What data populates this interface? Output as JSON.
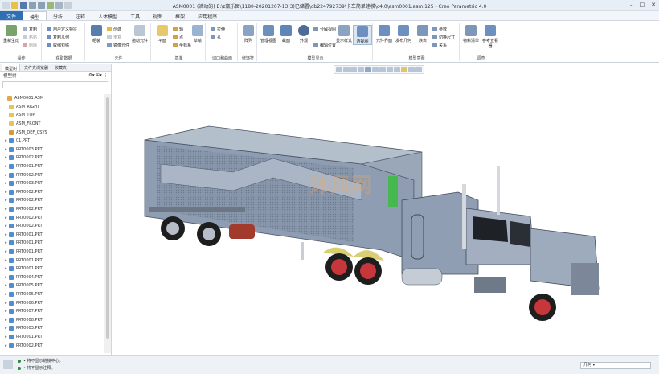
{
  "title": "ASM0001 (活动的) E:\\z赢乐图\\1180-20201207-13(3)已储置\\db224792739\\卡车简单建模\\c4.0\\asm0001.asm.125 - Creo Parametric 4.0",
  "tabs": [
    "文件",
    "模型",
    "分析",
    "注释",
    "人体模型",
    "工具",
    "视图",
    "框架",
    "应用程序"
  ],
  "ribbon": {
    "group_labels": [
      "操作",
      "获取数据",
      "元件",
      "基准",
      "切口和曲面",
      "修饰符",
      "模型显示",
      "模型意图",
      "调查"
    ],
    "buttons": {
      "regenerate": "重新生成",
      "copy": "复制",
      "paste": "粘贴",
      "delete": "删除",
      "user_feature": "用户定义特征",
      "copy_geom": "复制几何",
      "shrinkwrap": "收缩包络",
      "assemble": "组装",
      "create": "创建",
      "repeat": "重复",
      "mirror": "镜像元件",
      "drag": "拖动元件",
      "plane": "平面",
      "axis": "轴",
      "point": "点",
      "csys": "坐标系",
      "sketch": "草绘",
      "extrude": "拉伸",
      "hole": "孔",
      "pattern": "阵列",
      "manage_views": "管理视图",
      "section": "截面",
      "appearance": "外观",
      "explode": "分解视图",
      "edit_pos": "编辑位置",
      "display_style": "显示样式",
      "perspective": "透视图",
      "comp_interface": "元件界面",
      "publish_geom": "发布几何",
      "family_table": "族表",
      "params": "参数",
      "switch_dims": "切换尺寸",
      "relations": "关系",
      "bom": "物料清单",
      "ref_viewer": "参考查看器"
    }
  },
  "panel": {
    "tabs": [
      "模型树",
      "文件夹浏览器",
      "收藏夹"
    ],
    "toolbar_label": "模型树",
    "tree": [
      {
        "label": "ASM0001.ASM",
        "type": "asm",
        "arrow": ""
      },
      {
        "label": "ASM_RIGHT",
        "type": "plane",
        "arrow": ""
      },
      {
        "label": "ASM_TOP",
        "type": "plane",
        "arrow": ""
      },
      {
        "label": "ASM_FRONT",
        "type": "plane",
        "arrow": ""
      },
      {
        "label": "ASM_DEF_CSYS",
        "type": "csys",
        "arrow": ""
      },
      {
        "label": "01.PRT",
        "type": "part",
        "arrow": "▸"
      },
      {
        "label": "PRT0003.PRT",
        "type": "part",
        "arrow": "▸"
      },
      {
        "label": "PRT0002.PRT",
        "type": "part",
        "arrow": "▸"
      },
      {
        "label": "PRT0001.PRT",
        "type": "part",
        "arrow": "▸"
      },
      {
        "label": "PRT0002.PRT",
        "type": "part",
        "arrow": "▸"
      },
      {
        "label": "PRT0003.PRT",
        "type": "part",
        "arrow": "▸"
      },
      {
        "label": "PRT0002.PRT",
        "type": "part",
        "arrow": "▸"
      },
      {
        "label": "PRT0002.PRT",
        "type": "part",
        "arrow": "▸"
      },
      {
        "label": "PRT0002.PRT",
        "type": "part",
        "arrow": "▸"
      },
      {
        "label": "PRT0002.PRT",
        "type": "part",
        "arrow": "▸"
      },
      {
        "label": "PRT0002.PRT",
        "type": "part",
        "arrow": "▸"
      },
      {
        "label": "PRT0001.PRT",
        "type": "part",
        "arrow": "▸"
      },
      {
        "label": "PRT0001.PRT",
        "type": "part",
        "arrow": "▸"
      },
      {
        "label": "PRT0001.PRT",
        "type": "part",
        "arrow": "▸"
      },
      {
        "label": "PRT0001.PRT",
        "type": "part",
        "arrow": "▸"
      },
      {
        "label": "PRT0001.PRT",
        "type": "part",
        "arrow": "▸"
      },
      {
        "label": "PRT0004.PRT",
        "type": "part",
        "arrow": "▸"
      },
      {
        "label": "PRT0005.PRT",
        "type": "part",
        "arrow": "▸"
      },
      {
        "label": "PRT0005.PRT",
        "type": "part",
        "arrow": "▸"
      },
      {
        "label": "PRT0006.PRT",
        "type": "part",
        "arrow": "▸"
      },
      {
        "label": "PRT0007.PRT",
        "type": "part",
        "arrow": "▸"
      },
      {
        "label": "PRT0008.PRT",
        "type": "part",
        "arrow": "▸"
      },
      {
        "label": "PRT0003.PRT",
        "type": "part",
        "arrow": "▸"
      },
      {
        "label": "PRT0001.PRT",
        "type": "part",
        "arrow": "▸"
      },
      {
        "label": "PRT0002.PRT",
        "type": "part",
        "arrow": "▸"
      }
    ]
  },
  "watermark": "沐风网",
  "status": {
    "messages": [
      "• 将不显示链接中心。",
      "• 将不显示注释。"
    ],
    "filter": "几何"
  }
}
